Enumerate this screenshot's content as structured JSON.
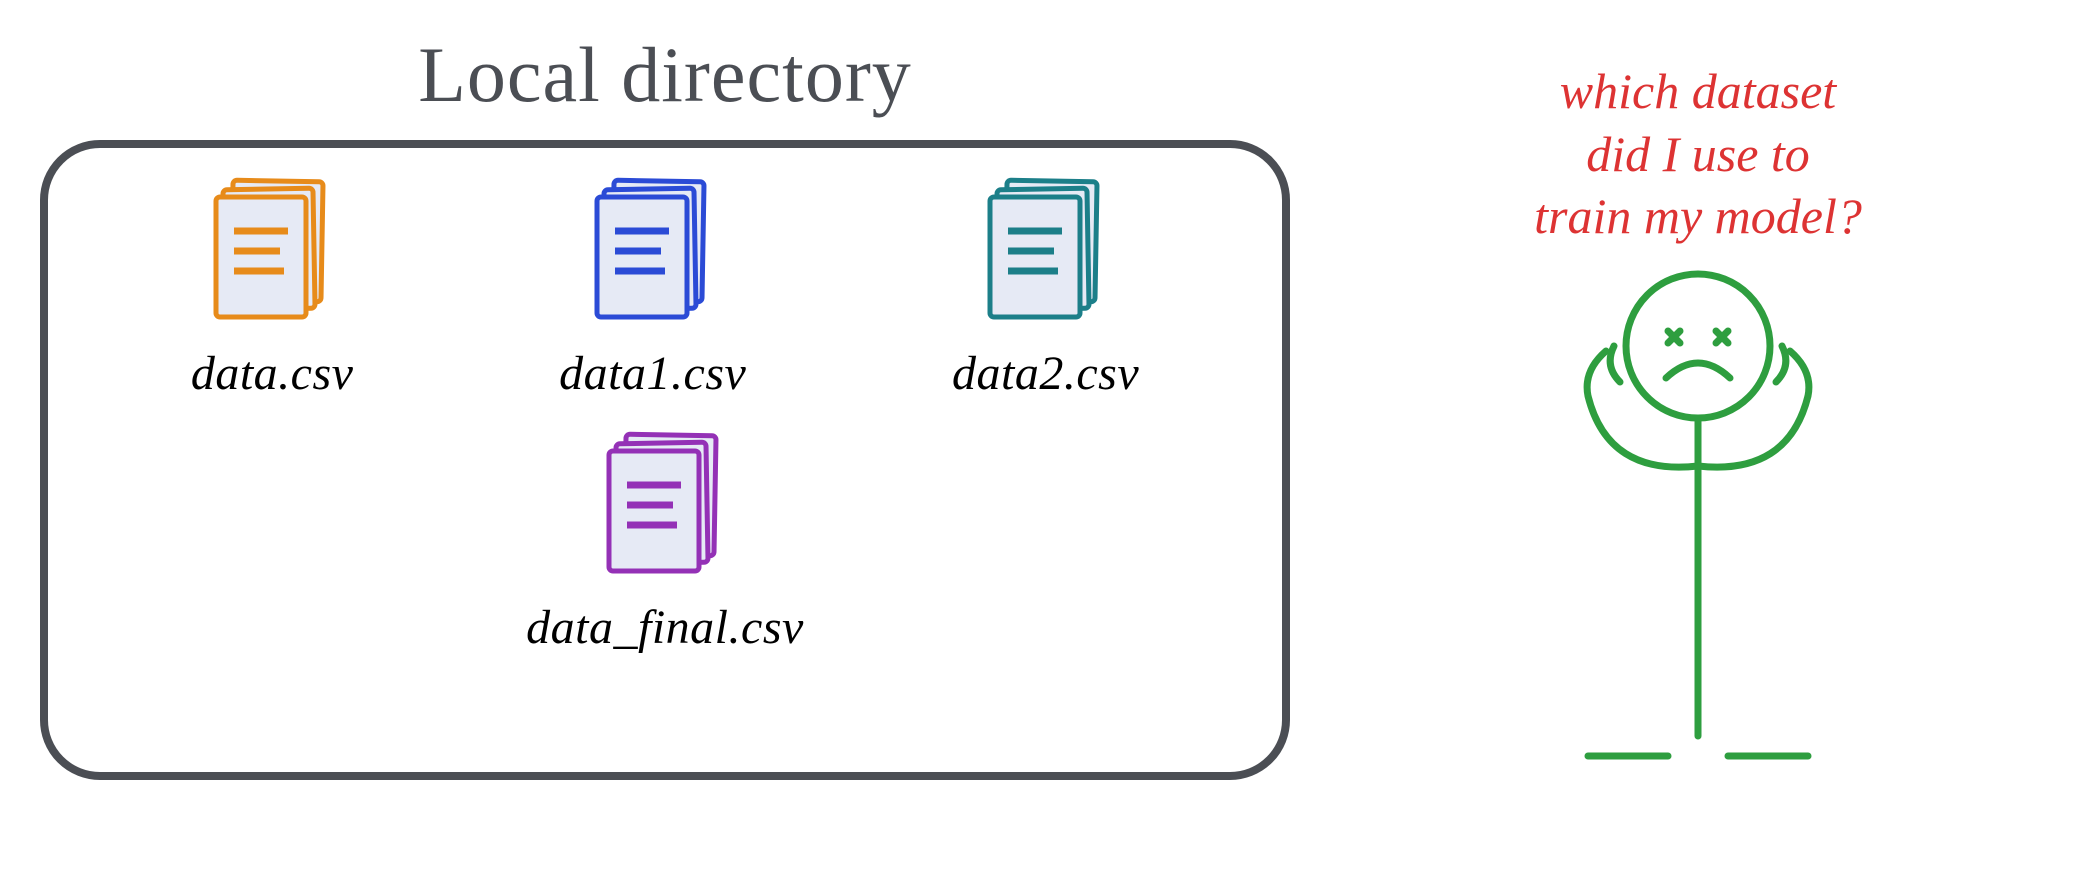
{
  "title": "Local directory",
  "files": [
    {
      "name": "data.csv",
      "color": "#e78b1a"
    },
    {
      "name": "data1.csv",
      "color": "#2b4bd6"
    },
    {
      "name": "data2.csv",
      "color": "#1c7f89"
    },
    {
      "name": "data_final.csv",
      "color": "#9431b6"
    }
  ],
  "question": "which dataset\ndid I use to\ntrain my model?",
  "person_color": "#2e9e3f"
}
